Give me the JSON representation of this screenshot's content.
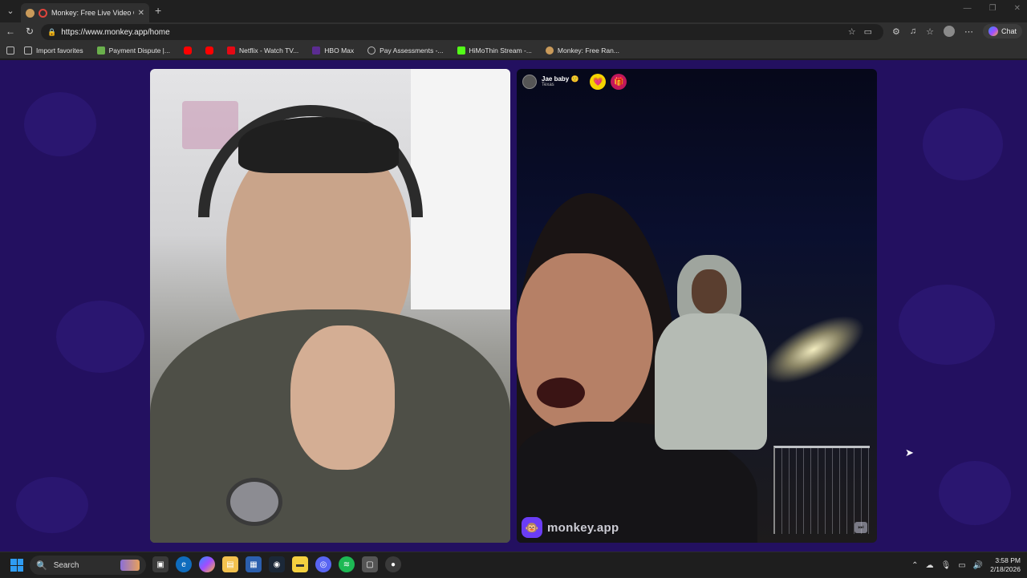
{
  "browser": {
    "tab_title": "Monkey: Free Live Video Chat",
    "tab_close": "✕",
    "new_tab": "+",
    "url": "https://www.monkey.app/home",
    "chat_label": "Chat"
  },
  "bookmarks": [
    {
      "label": "Import favorites",
      "color": "#bdbdbd"
    },
    {
      "label": "Payment Dispute |...",
      "color": "#6ab04c"
    },
    {
      "label": "",
      "color": "#ff0000"
    },
    {
      "label": "",
      "color": "#ff0000"
    },
    {
      "label": "Netflix - Watch TV...",
      "color": "#e50914"
    },
    {
      "label": "HBO Max",
      "color": "#5b2c91"
    },
    {
      "label": "Pay Assessments -...",
      "color": "#9e9e9e"
    },
    {
      "label": "HiMoThin Stream -...",
      "color": "#53fc18"
    },
    {
      "label": "Monkey: Free Ran...",
      "color": "#c99a5a"
    }
  ],
  "remote": {
    "name": "Jae baby 🙂",
    "location": "Texas",
    "badge_heart": "💗",
    "badge_gift": "🎁"
  },
  "watermark": {
    "text": "monkey.app",
    "logo": "🐵"
  },
  "taskbar": {
    "search_label": "Search",
    "time": "3:58 PM",
    "date": "2/18/2026"
  },
  "colors": {
    "page_bg": "#231060",
    "accent": "#6b3df5"
  }
}
